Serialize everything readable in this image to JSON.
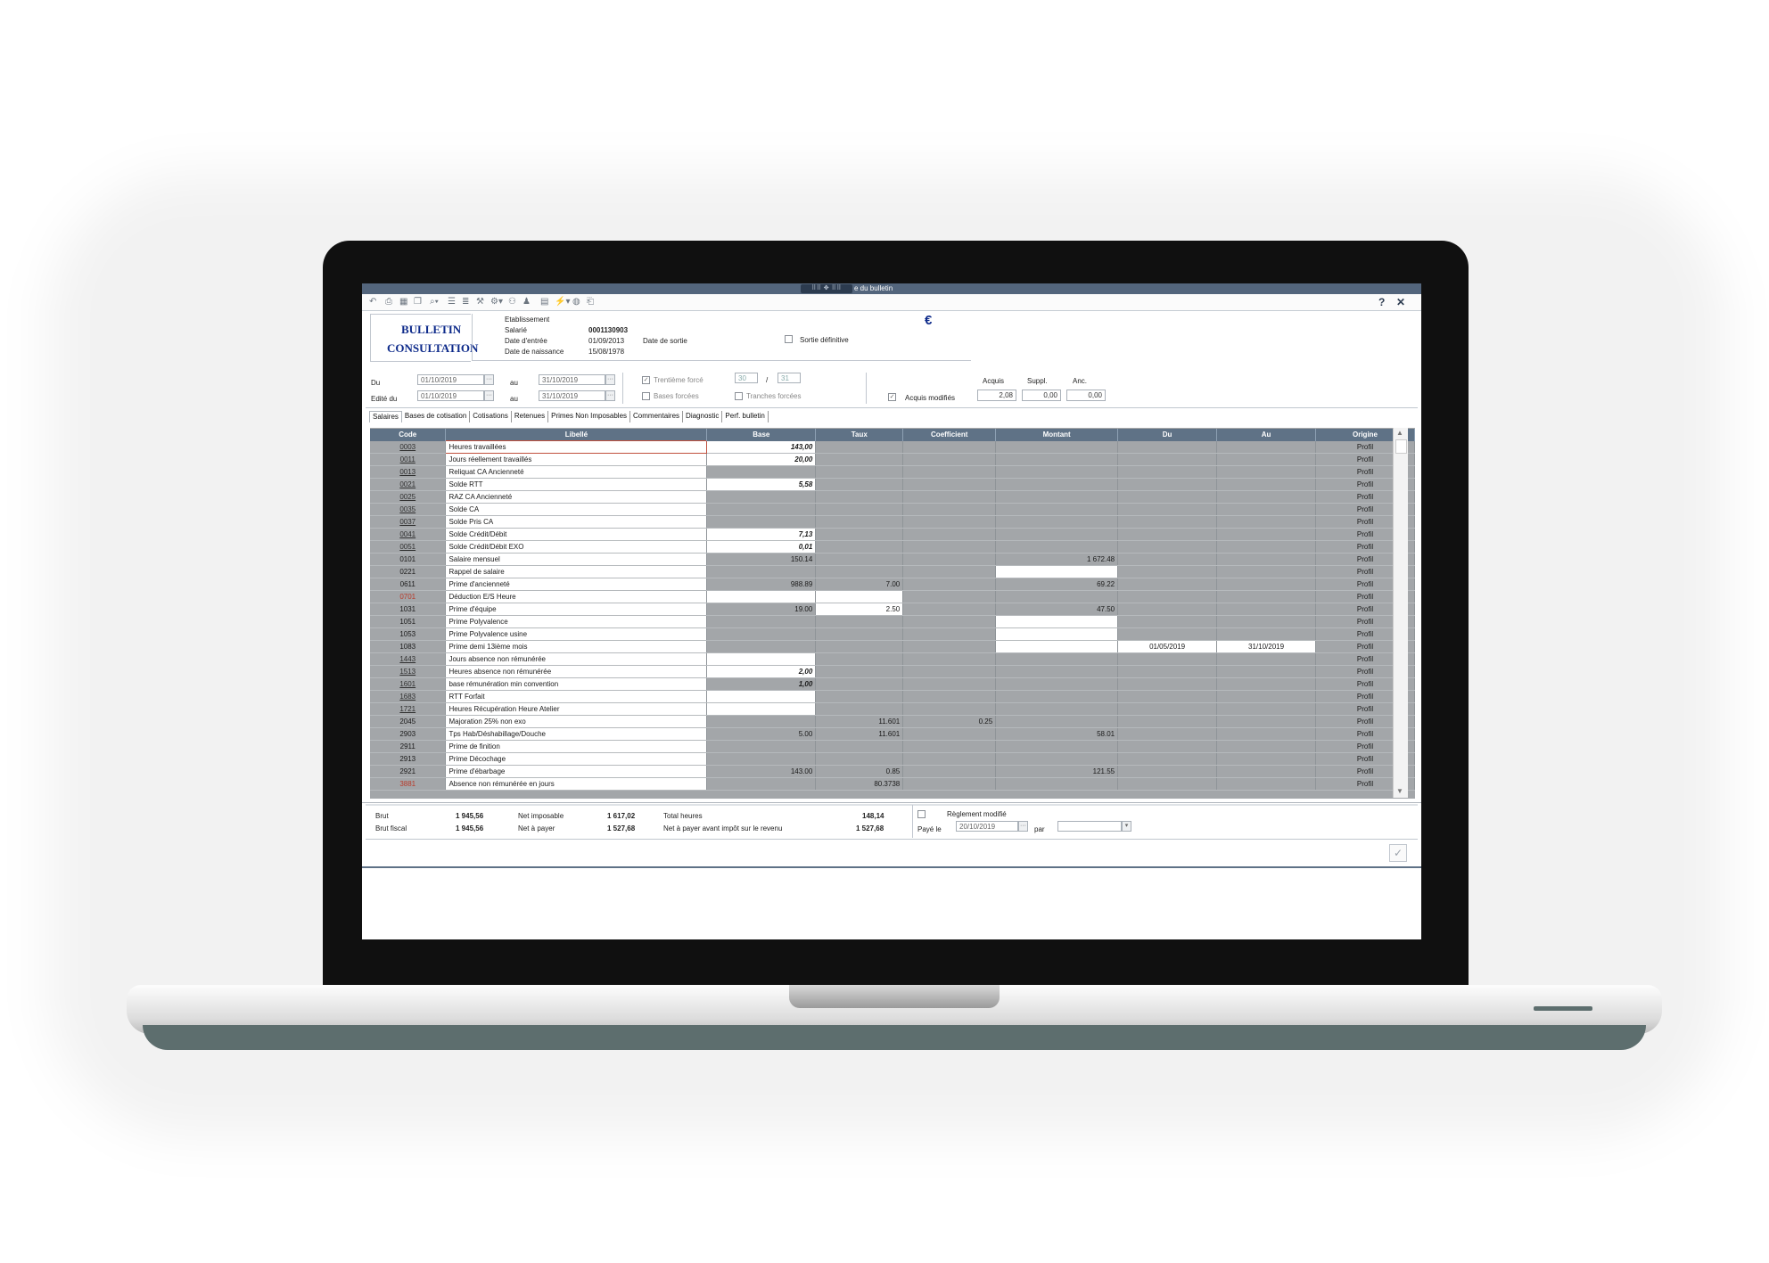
{
  "window": {
    "grip": "⠿⠿ ✥ ⠿⠿",
    "title": "e du bulletin"
  },
  "toolbar": {
    "help": "?",
    "close": "✕"
  },
  "badge": {
    "line1": "BULLETIN",
    "line2": "CONSULTATION"
  },
  "employee": {
    "etablissement_label": "Etablissement",
    "salarie_label": "Salarié",
    "salarie_value": "0001130903",
    "date_entree_label": "Date d'entrée",
    "date_entree_value": "01/09/2013",
    "date_sortie_label": "Date de sortie",
    "date_naissance_label": "Date de naissance",
    "date_naissance_value": "15/08/1978",
    "sortie_definitive_label": "Sortie définitive",
    "currency_symbol": "€"
  },
  "period": {
    "du_label": "Du",
    "du_value": "01/10/2019",
    "au_label": "au",
    "au_value": "31/10/2019",
    "edite_label": "Edité du",
    "edite_value": "01/10/2019",
    "edite_au_label": "au",
    "edite_au_value": "31/10/2019",
    "ellipsis": "···"
  },
  "options": {
    "trentieme_label": "Trentième forcé",
    "trentieme_num": "30",
    "slash": "/",
    "trentieme_den": "31",
    "bases_forcees_label": "Bases forcées",
    "tranches_forcees_label": "Tranches forcées",
    "acquis_modifies_label": "Acquis modifiés",
    "acquis_label": "Acquis",
    "acquis_value": "2,08",
    "suppl_label": "Suppl.",
    "suppl_value": "0,00",
    "anc_label": "Anc.",
    "anc_value": "0,00"
  },
  "tabs": [
    "Salaires",
    "Bases de cotisation",
    "Cotisations",
    "Retenues",
    "Primes Non Imposables",
    "Commentaires",
    "Diagnostic",
    "Perf. bulletin"
  ],
  "grid": {
    "columns": [
      "Code",
      "Libellé",
      "Base",
      "Taux",
      "Coefficient",
      "Montant",
      "Du",
      "Au",
      "Origine"
    ],
    "rows": [
      {
        "code": "0003",
        "lib": "Heures travaillées",
        "base": "143,00",
        "taux": "",
        "coef": "",
        "montant": "",
        "du": "",
        "au": "",
        "origine": "Profil"
      },
      {
        "code": "0011",
        "lib": "Jours réellement travaillés",
        "base": "20,00",
        "taux": "",
        "coef": "",
        "montant": "",
        "du": "",
        "au": "",
        "origine": "Profil"
      },
      {
        "code": "0013",
        "lib": "Reliquat CA Ancienneté",
        "base": "",
        "taux": "",
        "coef": "",
        "montant": "",
        "du": "",
        "au": "",
        "origine": "Profil"
      },
      {
        "code": "0021",
        "lib": "Solde RTT",
        "base": "5,58",
        "taux": "",
        "coef": "",
        "montant": "",
        "du": "",
        "au": "",
        "origine": "Profil"
      },
      {
        "code": "0025",
        "lib": "RAZ CA Ancienneté",
        "base": "",
        "taux": "",
        "coef": "",
        "montant": "",
        "du": "",
        "au": "",
        "origine": "Profil"
      },
      {
        "code": "0035",
        "lib": "Solde CA",
        "base": "",
        "taux": "",
        "coef": "",
        "montant": "",
        "du": "",
        "au": "",
        "origine": "Profil"
      },
      {
        "code": "0037",
        "lib": "Solde Pris CA",
        "base": "",
        "taux": "",
        "coef": "",
        "montant": "",
        "du": "",
        "au": "",
        "origine": "Profil"
      },
      {
        "code": "0041",
        "lib": "Solde Crédit/Débit",
        "base": "7,13",
        "taux": "",
        "coef": "",
        "montant": "",
        "du": "",
        "au": "",
        "origine": "Profil"
      },
      {
        "code": "0051",
        "lib": "Solde Crédit/Débit EXO",
        "base": "0,01",
        "taux": "",
        "coef": "",
        "montant": "",
        "du": "",
        "au": "",
        "origine": "Profil"
      },
      {
        "code": "0101",
        "lib": "Salaire mensuel",
        "base": "150.14",
        "taux": "",
        "coef": "",
        "montant": "1 672.48",
        "du": "",
        "au": "",
        "origine": "Profil"
      },
      {
        "code": "0221",
        "lib": "Rappel de salaire",
        "base": "",
        "taux": "",
        "coef": "",
        "montant": "",
        "du": "",
        "au": "",
        "origine": "Profil"
      },
      {
        "code": "0611",
        "lib": "Prime d'ancienneté",
        "base": "988.89",
        "taux": "7.00",
        "coef": "",
        "montant": "69.22",
        "du": "",
        "au": "",
        "origine": "Profil"
      },
      {
        "code": "0701",
        "lib": "Déduction E/S Heure",
        "base": "",
        "taux": "",
        "coef": "",
        "montant": "",
        "du": "",
        "au": "",
        "origine": "Profil"
      },
      {
        "code": "1031",
        "lib": "Prime d'équipe",
        "base": "19.00",
        "taux": "2.50",
        "coef": "",
        "montant": "47.50",
        "du": "",
        "au": "",
        "origine": "Profil"
      },
      {
        "code": "1051",
        "lib": "Prime Polyvalence",
        "base": "",
        "taux": "",
        "coef": "",
        "montant": "",
        "du": "",
        "au": "",
        "origine": "Profil"
      },
      {
        "code": "1053",
        "lib": "Prime Polyvalence usine",
        "base": "",
        "taux": "",
        "coef": "",
        "montant": "",
        "du": "",
        "au": "",
        "origine": "Profil"
      },
      {
        "code": "1083",
        "lib": "Prime demi 13ième mois",
        "base": "",
        "taux": "",
        "coef": "",
        "montant": "",
        "du": "01/05/2019",
        "au": "31/10/2019",
        "origine": "Profil"
      },
      {
        "code": "1443",
        "lib": "Jours absence non rémunérée",
        "base": "",
        "taux": "",
        "coef": "",
        "montant": "",
        "du": "",
        "au": "",
        "origine": "Profil"
      },
      {
        "code": "1513",
        "lib": "Heures absence non rémunérée",
        "base": "2,00",
        "taux": "",
        "coef": "",
        "montant": "",
        "du": "",
        "au": "",
        "origine": "Profil"
      },
      {
        "code": "1601",
        "lib": "base rémunération  min convention",
        "base": "1,00",
        "taux": "",
        "coef": "",
        "montant": "",
        "du": "",
        "au": "",
        "origine": "Profil"
      },
      {
        "code": "1683",
        "lib": "RTT Forfait",
        "base": "",
        "taux": "",
        "coef": "",
        "montant": "",
        "du": "",
        "au": "",
        "origine": "Profil"
      },
      {
        "code": "1721",
        "lib": "Heures Récupération Heure Atelier",
        "base": "",
        "taux": "",
        "coef": "",
        "montant": "",
        "du": "",
        "au": "",
        "origine": "Profil"
      },
      {
        "code": "2045",
        "lib": "Majoration 25% non exo",
        "base": "",
        "taux": "11.601",
        "coef": "0.25",
        "montant": "",
        "du": "",
        "au": "",
        "origine": "Profil"
      },
      {
        "code": "2903",
        "lib": "Tps Hab/Déshabillage/Douche",
        "base": "5.00",
        "taux": "11.601",
        "coef": "",
        "montant": "58.01",
        "du": "",
        "au": "",
        "origine": "Profil"
      },
      {
        "code": "2911",
        "lib": "Prime de finition",
        "base": "",
        "taux": "",
        "coef": "",
        "montant": "",
        "du": "",
        "au": "",
        "origine": "Profil"
      },
      {
        "code": "2913",
        "lib": "Prime Décochage",
        "base": "",
        "taux": "",
        "coef": "",
        "montant": "",
        "du": "",
        "au": "",
        "origine": "Profil"
      },
      {
        "code": "2921",
        "lib": "Prime d'ébarbage",
        "base": "143.00",
        "taux": "0.85",
        "coef": "",
        "montant": "121.55",
        "du": "",
        "au": "",
        "origine": "Profil"
      },
      {
        "code": "3881",
        "lib": "Absence non rémunérée en jours",
        "base": "",
        "taux": "80.3738",
        "coef": "",
        "montant": "",
        "du": "",
        "au": "",
        "origine": "Profil"
      }
    ]
  },
  "totals": {
    "brut_label": "Brut",
    "brut_value": "1 945,56",
    "brut_fiscal_label": "Brut fiscal",
    "brut_fiscal_value": "1 945,56",
    "net_imposable_label": "Net imposable",
    "net_imposable_value": "1 617,02",
    "net_a_payer_label": "Net à payer",
    "net_a_payer_value": "1 527,68",
    "total_heures_label": "Total heures",
    "total_heures_value": "148,14",
    "net_avant_impot_label": "Net à payer avant impôt sur le revenu",
    "net_avant_impot_value": "1 527,68",
    "reglement_modifie_label": "Règlement modifié",
    "paye_le_label": "Payé le",
    "paye_le_value": "20/10/2019",
    "par_label": "par",
    "par_value": "",
    "ok_glyph": "✓"
  },
  "colors": {
    "titlebar": "#53657c",
    "grid_header": "#5f7286",
    "grid_bg": "#a3a6a9",
    "brand": "#0d2a8a"
  }
}
